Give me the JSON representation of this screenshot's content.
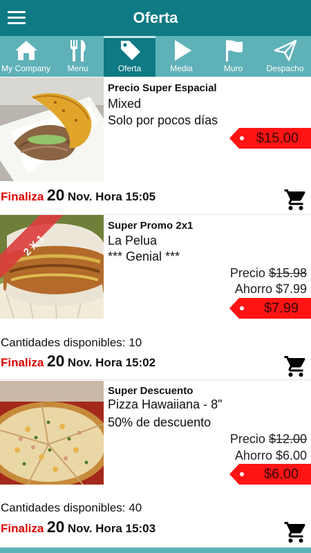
{
  "header": {
    "title": "Oferta",
    "menu_icon": "hamburger-menu-icon",
    "bar_color": "#0e7a83"
  },
  "tabs": [
    {
      "label": "My Company",
      "icon": "home-icon",
      "active": false
    },
    {
      "label": "Menu",
      "icon": "fork-knife-icon",
      "active": false
    },
    {
      "label": "Oferta",
      "icon": "price-tag-icon",
      "active": true
    },
    {
      "label": "Media",
      "icon": "play-icon",
      "active": false
    },
    {
      "label": "Muro",
      "icon": "flag-icon",
      "active": false
    },
    {
      "label": "Despacho",
      "icon": "paper-plane-icon",
      "active": false
    }
  ],
  "offers": [
    {
      "heading": "Precio Super Espacial",
      "name": "Mixed",
      "note": "Solo por pocos días",
      "price": "$15.00",
      "finaliza_label": "Finaliza",
      "day": "20",
      "month_time": "Nov. Hora 15:05",
      "cart_icon": "shopping-cart-icon"
    },
    {
      "heading": "Super Promo 2x1",
      "name": "La Pelua",
      "note": "*** Genial ***",
      "ribbon": "2 X 1",
      "precio_label": "Precio",
      "old_price": "$15.98",
      "ahorro": "Ahorro $7.99",
      "price": "$7.99",
      "qty_label": "Cantidades disponibles:",
      "qty": "10",
      "finaliza_label": "Finaliza",
      "day": "20",
      "month_time": "Nov. Hora 15:02",
      "cart_icon": "shopping-cart-icon"
    },
    {
      "heading": "Super Descuento",
      "name": "Pizza Hawaiiana - 8\"",
      "note": "50% de descuento",
      "precio_label": "Precio",
      "old_price": "$12.00",
      "ahorro": "Ahorro $6.00",
      "price": "$6.00",
      "qty_label": "Cantidades disponibles:",
      "qty": "40",
      "finaliza_label": "Finaliza",
      "day": "20",
      "month_time": "Nov. Hora 15:03",
      "cart_icon": "shopping-cart-icon"
    }
  ],
  "colors": {
    "accent": "#0e7a83",
    "tab_bar": "#5fb1b8",
    "price_tag": "#ff1414",
    "finaliza": "#e00000"
  }
}
